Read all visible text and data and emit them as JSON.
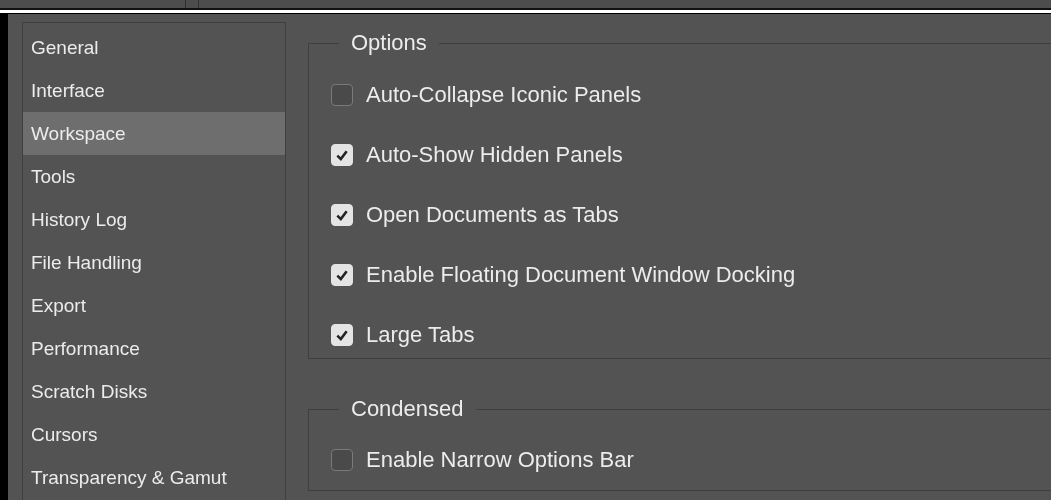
{
  "sidebar": {
    "items": [
      {
        "label": "General",
        "selected": false
      },
      {
        "label": "Interface",
        "selected": false
      },
      {
        "label": "Workspace",
        "selected": true
      },
      {
        "label": "Tools",
        "selected": false
      },
      {
        "label": "History Log",
        "selected": false
      },
      {
        "label": "File Handling",
        "selected": false
      },
      {
        "label": "Export",
        "selected": false
      },
      {
        "label": "Performance",
        "selected": false
      },
      {
        "label": "Scratch Disks",
        "selected": false
      },
      {
        "label": "Cursors",
        "selected": false
      },
      {
        "label": "Transparency & Gamut",
        "selected": false
      }
    ]
  },
  "groups": [
    {
      "title": "Options",
      "options": [
        {
          "label": "Auto-Collapse Iconic Panels",
          "checked": false
        },
        {
          "label": "Auto-Show Hidden Panels",
          "checked": true
        },
        {
          "label": "Open Documents as Tabs",
          "checked": true
        },
        {
          "label": "Enable Floating Document Window Docking",
          "checked": true
        },
        {
          "label": "Large Tabs",
          "checked": true
        }
      ]
    },
    {
      "title": "Condensed",
      "options": [
        {
          "label": "Enable Narrow Options Bar",
          "checked": false
        }
      ]
    }
  ]
}
